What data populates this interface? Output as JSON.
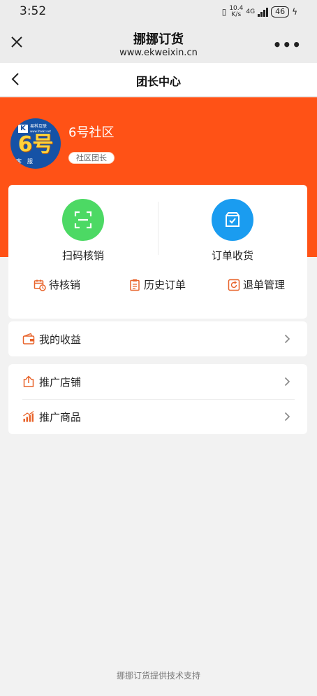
{
  "status_bar": {
    "time": "3:52",
    "net_speed_value": "10.4",
    "net_speed_unit": "K/s",
    "network": "4G",
    "battery": "46"
  },
  "browser": {
    "title": "挪挪订货",
    "url": "www.ekweixin.cn",
    "close_icon": "close-icon",
    "more_label": "•••"
  },
  "nav": {
    "title": "团长中心",
    "back_icon": "chevron-left-icon"
  },
  "profile": {
    "name": "6号社区",
    "role": "社区团长",
    "avatar": {
      "brand_letter": "K",
      "brand_name": "易科互联",
      "brand_url": "www.fmekr.net",
      "big_text": "6号",
      "sub_text": "客服"
    }
  },
  "actions": [
    {
      "label": "扫码核销",
      "icon": "scan-icon",
      "color": "#4cd964"
    },
    {
      "label": "订单收货",
      "icon": "box-check-icon",
      "color": "#1a9cf0"
    }
  ],
  "sub_actions": [
    {
      "label": "待核销",
      "icon": "clock-calendar-icon"
    },
    {
      "label": "历史订单",
      "icon": "clipboard-icon"
    },
    {
      "label": "退单管理",
      "icon": "refund-icon"
    }
  ],
  "menu_group_1": [
    {
      "label": "我的收益",
      "icon": "wallet-icon"
    }
  ],
  "menu_group_2": [
    {
      "label": "推广店铺",
      "icon": "share-icon"
    },
    {
      "label": "推广商品",
      "icon": "chart-icon"
    }
  ],
  "footer": "挪挪订货提供技术支持",
  "colors": {
    "accent": "#ff5216",
    "icon_orange": "#e8632a"
  }
}
